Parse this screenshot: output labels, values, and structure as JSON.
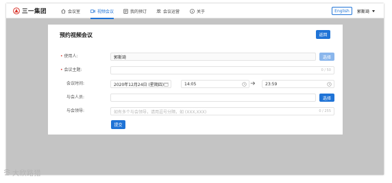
{
  "app": {
    "logo_text": "三一集团",
    "brand_color": "#d9342b",
    "accent_color": "#1f73d6"
  },
  "nav": {
    "items": [
      {
        "label": "会议室",
        "icon": "home-icon"
      },
      {
        "label": "视频会议",
        "icon": "video-icon",
        "active": true
      },
      {
        "label": "我的预订",
        "icon": "calendar-icon"
      },
      {
        "label": "会议运营",
        "icon": "users-icon"
      },
      {
        "label": "关于",
        "icon": "info-icon"
      }
    ]
  },
  "header": {
    "lang_button": "English",
    "user_name": "郭斯琦"
  },
  "form": {
    "title": "预约视频会议",
    "back_label": "返回",
    "user": {
      "label": "使用人:",
      "value": "郭斯琦",
      "button": "选择"
    },
    "subject": {
      "label": "会议主题:",
      "value": "",
      "counter": "0 / 50"
    },
    "time": {
      "label": "会议时间:",
      "date": "2020年12月24日 (星期四)",
      "start": "14:05",
      "end": "23:59"
    },
    "attendees": {
      "label": "与会人员:",
      "value": "",
      "button": "选择"
    },
    "leaders": {
      "label": "与会领导:",
      "placeholder": "如有多个与会领导，请用逗号分隔，如 (XXX,XXX)",
      "counter": "0 / 255"
    },
    "submit_label": "提交"
  },
  "watermark": {
    "text": "大欣路猎"
  }
}
